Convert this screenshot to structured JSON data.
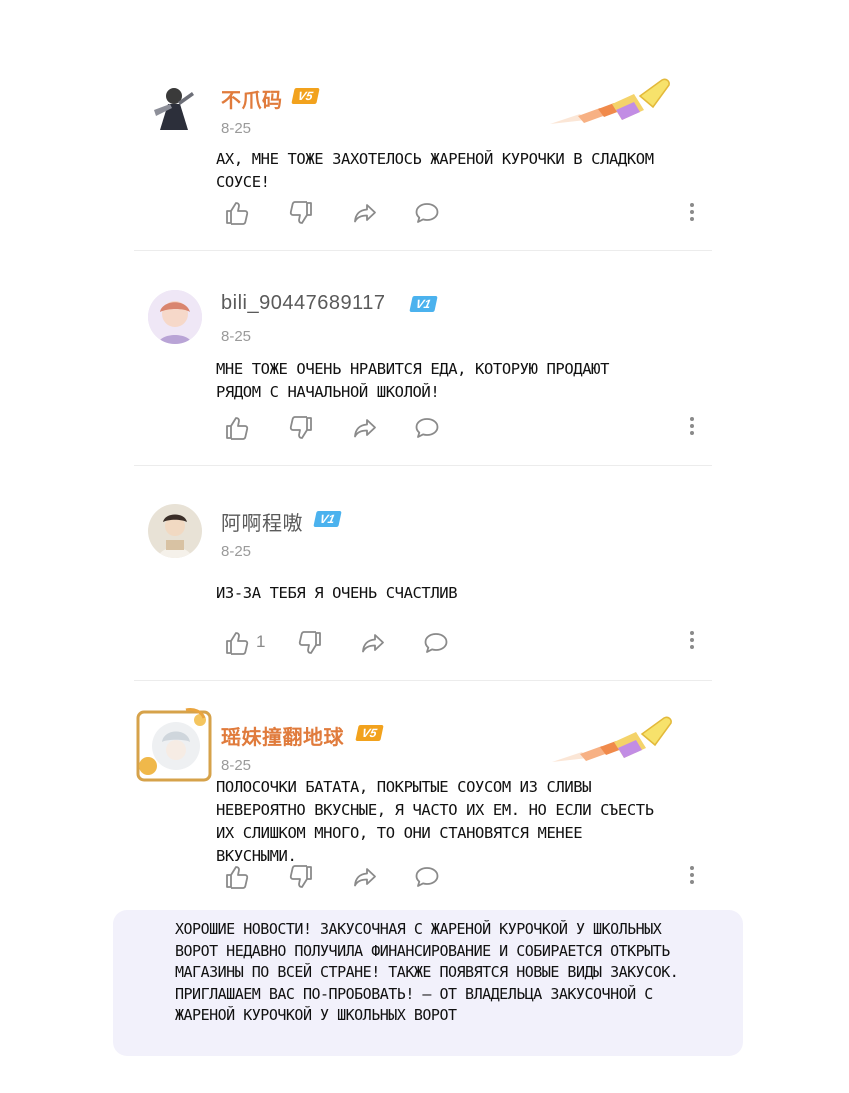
{
  "comments": [
    {
      "username": "不爪码",
      "level": "V5",
      "date": "8-25",
      "text": "Ах, мне тоже захотелось жареной курочки в сладком соусе!",
      "likes": ""
    },
    {
      "username": "bili_90447689117",
      "level": "V1",
      "date": "8-25",
      "text": "Мне тоже очень нравится еда, которую продают рядом с начальной школой!",
      "likes": ""
    },
    {
      "username": "阿啊程嗷",
      "level": "V1",
      "date": "8-25",
      "text": "Из-за тебя я очень счастлив",
      "likes": "1"
    },
    {
      "username": "瑶妹撞翻地球",
      "level": "V5",
      "date": "8-25",
      "text": "Полосочки батата, покрытые соусом из сливы невероятно вкусные, я часто их ем. Но если съесть их слишком много, то они становятся менее вкусными.",
      "likes": ""
    }
  ],
  "note": {
    "text": "Хорошие новости! Закусочная с жареной курочкой у школьных ворот недавно получила финансирование и собирается открыть магазины по всей стране! Также появятся новые виды закусок. Приглашаем вас по-пробовать! — от владельца закусочной с жареной курочкой у школьных ворот"
  },
  "icons": {
    "like": "thumbs-up-icon",
    "dislike": "thumbs-down-icon",
    "share": "share-arrow-icon",
    "reply": "comment-bubble-icon",
    "more": "more-vertical-icon",
    "decoration": "paint-brush-icon"
  },
  "colors": {
    "vip_name": "#e07b3c",
    "level_v5": "#f2a21d",
    "level_v1": "#4bb2ee",
    "note_bg": "#f2f1fb"
  }
}
